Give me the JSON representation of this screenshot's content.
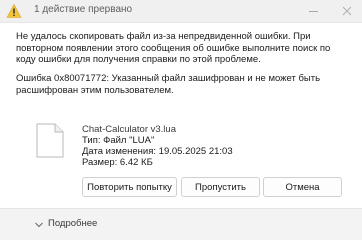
{
  "window": {
    "title": "1 действие прервано",
    "minimize_icon": "minimize-icon",
    "close_icon": "close-icon"
  },
  "message": {
    "main": "Не удалось скопировать файл из-за непредвиденной ошибки. При повторном появлении этого сообщения об ошибке выполните поиск по коду ошибки для получения справки по этой проблеме.",
    "error": "Ошибка 0x80071772: Указанный файл зашифрован и не может быть расшифрован этим пользователем."
  },
  "file": {
    "name": "Chat-Calculator v3.lua",
    "type": "Тип: Файл \"LUA\"",
    "modified": "Дата изменения: 19.05.2025 21:03",
    "size": "Размер: 6.42 КБ"
  },
  "buttons": {
    "retry": "Повторить попытку",
    "skip": "Пропустить",
    "cancel": "Отмена"
  },
  "footer": {
    "more": "Подробнее"
  },
  "colors": {
    "warning": "#f3c33d",
    "accent": "#0067c0"
  }
}
